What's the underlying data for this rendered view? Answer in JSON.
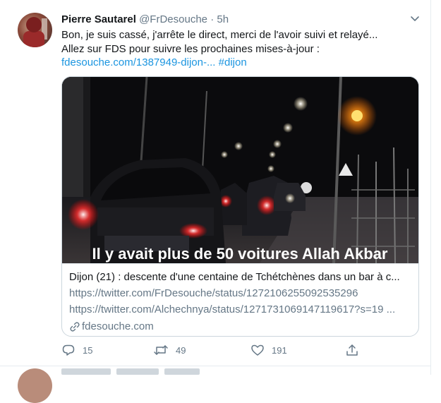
{
  "tweet": {
    "author_name": "Pierre Sautarel",
    "author_handle": "@FrDesouche",
    "separator": "·",
    "time": "5h",
    "text_line1": "Bon, je suis cassé, j'arrête le direct, merci de l'avoir suivi et relayé...",
    "text_line2": "Allez sur FDS pour suivre les prochaines mises-à-jour :",
    "link_text": "fdesouche.com/1387949-dijon-...",
    "hashtag": "#dijon",
    "card": {
      "title": "Dijon (21) : descente d'une centaine de Tchétchènes dans un bar à c...",
      "url1": "https://twitter.com/FrDesouche/status/1272106255092535296",
      "url2": "https://twitter.com/Alchechnya/status/1271731069147119617?s=19 ...",
      "domain": "fdesouche.com",
      "caption": "Il y avait plus de 50 voitures Allah Akbar"
    },
    "actions": {
      "reply_count": "15",
      "retweet_count": "49",
      "like_count": "191"
    }
  },
  "icons": [
    "caret-down-icon",
    "reply-icon",
    "retweet-icon",
    "like-icon",
    "share-icon",
    "link-icon"
  ],
  "colors": {
    "link": "#1b95e0",
    "secondary": "#657786",
    "border": "#ccd6dd"
  }
}
